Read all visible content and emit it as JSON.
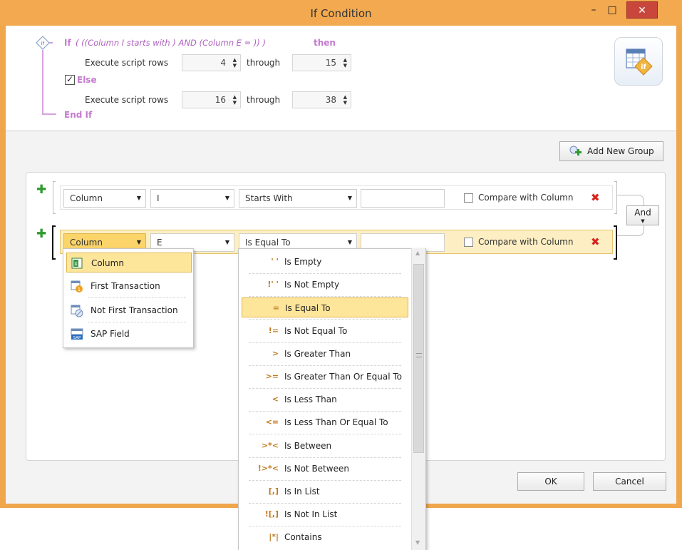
{
  "window": {
    "title": "If Condition",
    "minimize_glyph": "–",
    "maximize_glyph": "□",
    "close_glyph": "✕"
  },
  "header": {
    "if_keyword": "If",
    "condition_text": "( ((Column I starts with ) AND (Column E = )) )",
    "then_keyword": "then",
    "execute_label_1": "Execute script rows",
    "from_1": "4",
    "through_label_1": "through",
    "to_1": "15",
    "else_checked": true,
    "else_keyword": "Else",
    "execute_label_2": "Execute script rows",
    "from_2": "16",
    "through_label_2": "through",
    "to_2": "38",
    "end_if_keyword": "End If",
    "icon": "if-script-icon"
  },
  "toolbar": {
    "add_group_label": "Add New Group",
    "add_group_icon": "add-group-icon"
  },
  "conditions": [
    {
      "source": "Column",
      "field": "I",
      "operator": "Starts With",
      "value": "",
      "compare_label": "Compare with Column",
      "compare_checked": false
    },
    {
      "source": "Column",
      "field": "E",
      "operator": "Is Equal To",
      "value": "",
      "compare_label": "Compare with Column",
      "compare_checked": false
    }
  ],
  "connector": {
    "label": "And"
  },
  "source_menu": {
    "items": [
      {
        "label": "Column",
        "icon": "excel-column-icon",
        "selected": true
      },
      {
        "label": "First Transaction",
        "icon": "first-transaction-icon",
        "selected": false
      },
      {
        "label": "Not First Transaction",
        "icon": "not-first-transaction-icon",
        "selected": false
      },
      {
        "label": "SAP Field",
        "icon": "sap-field-icon",
        "selected": false
      }
    ]
  },
  "operator_menu": {
    "items": [
      {
        "symbol": "' '",
        "label": "Is Empty"
      },
      {
        "symbol": "!' '",
        "label": "Is Not Empty"
      },
      {
        "symbol": "=",
        "label": "Is Equal To",
        "selected": true
      },
      {
        "symbol": "!=",
        "label": "Is Not Equal To"
      },
      {
        "symbol": ">",
        "label": "Is Greater Than"
      },
      {
        "symbol": ">=",
        "label": "Is Greater Than Or Equal To"
      },
      {
        "symbol": "<",
        "label": "Is Less Than"
      },
      {
        "symbol": "<=",
        "label": "Is Less Than Or Equal To"
      },
      {
        "symbol": ">*<",
        "label": "Is Between"
      },
      {
        "symbol": "!>*<",
        "label": "Is Not Between"
      },
      {
        "symbol": "[,]",
        "label": "Is In List"
      },
      {
        "symbol": "![,]",
        "label": "Is Not In List"
      },
      {
        "symbol": "|*|",
        "label": "Contains"
      }
    ]
  },
  "footer": {
    "ok_label": "OK",
    "cancel_label": "Cancel"
  },
  "colors": {
    "window_border": "#f0a64a",
    "keyword": "#c57ad0",
    "selection": "#fde59a",
    "delete": "#d9231c",
    "add": "#2f9b2f"
  }
}
